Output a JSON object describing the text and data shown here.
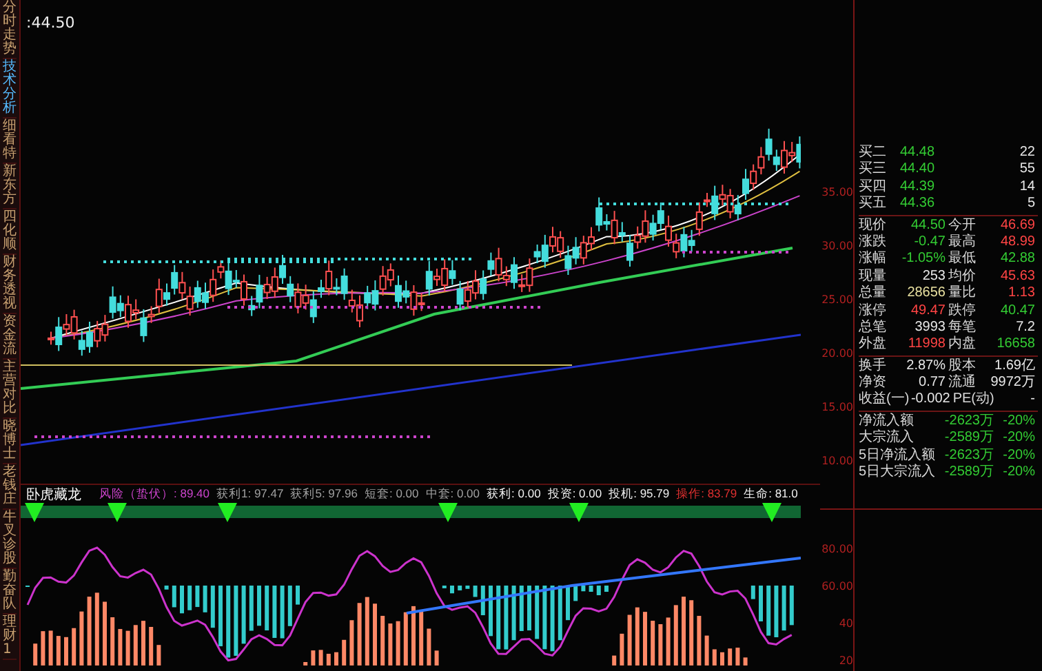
{
  "sidebar": {
    "tabs": [
      {
        "label": "分时走势",
        "selected": false
      },
      {
        "label": "技术分析",
        "selected": true
      },
      {
        "label": "细看特",
        "selected": false
      },
      {
        "label": "新东方",
        "selected": false
      },
      {
        "label": "四化顺",
        "selected": false
      },
      {
        "label": "财务透视",
        "selected": false
      },
      {
        "label": "资金流",
        "selected": false
      },
      {
        "label": "主营对比",
        "selected": false
      },
      {
        "label": "晓博士",
        "selected": false
      },
      {
        "label": "老钱庄",
        "selected": false
      },
      {
        "label": "牛叉诊股",
        "selected": false
      },
      {
        "label": "勤奋队",
        "selected": false
      },
      {
        "label": "理财1",
        "selected": false
      }
    ]
  },
  "main_chart": {
    "price_label": ":44.50",
    "axis_labels": [
      "35.00",
      "30.00",
      "25.00",
      "20.00",
      "15.00",
      "10.00"
    ]
  },
  "quote": {
    "bids": [
      {
        "label": "买二",
        "price": "44.48",
        "volume": "22"
      },
      {
        "label": "买三",
        "price": "44.40",
        "volume": "55"
      },
      {
        "label": "买四",
        "price": "44.39",
        "volume": "14"
      },
      {
        "label": "买五",
        "price": "44.36",
        "volume": "5"
      }
    ],
    "stats": [
      {
        "label": "现价",
        "value": "44.50",
        "color": "#33cc33"
      },
      {
        "label": "今开",
        "value": "46.69",
        "color": "#ff4444"
      },
      {
        "label": "涨跌",
        "value": "-0.47",
        "color": "#33cc33"
      },
      {
        "label": "最高",
        "value": "48.99",
        "color": "#ff4444"
      },
      {
        "label": "涨幅",
        "value": "-1.05%",
        "color": "#33cc33"
      },
      {
        "label": "最低",
        "value": "42.88",
        "color": "#33cc33"
      },
      {
        "label": "现量",
        "value": "253",
        "color": "#e8e8e8"
      },
      {
        "label": "均价",
        "value": "45.63",
        "color": "#ff4444"
      },
      {
        "label": "总量",
        "value": "28656",
        "color": "#e8e0a0"
      },
      {
        "label": "量比",
        "value": "1.13",
        "color": "#ff4444"
      },
      {
        "label": "涨停",
        "value": "49.47",
        "color": "#ff4444"
      },
      {
        "label": "跌停",
        "value": "40.47",
        "color": "#33cc33"
      },
      {
        "label": "总笔",
        "value": "3993",
        "color": "#e8e8e8"
      },
      {
        "label": "每笔",
        "value": "7.2",
        "color": "#e8e8e8"
      },
      {
        "label": "外盘",
        "value": "11998",
        "color": "#ff4444"
      },
      {
        "label": "内盘",
        "value": "16658",
        "color": "#33cc33"
      },
      {
        "label": "换手",
        "value": "2.87%",
        "color": "#e8e8e8"
      },
      {
        "label": "股本",
        "value": "1.69亿",
        "color": "#e8e8e8"
      },
      {
        "label": "净资",
        "value": "0.77",
        "color": "#e8e8e8"
      },
      {
        "label": "流通",
        "value": "9972万",
        "color": "#e8e8e8"
      },
      {
        "label": "收益(一)",
        "value": "-0.002",
        "color": "#e8e8e8"
      },
      {
        "label": "PE(动)",
        "value": "-",
        "color": "#e8e8e8"
      }
    ],
    "flows": [
      {
        "label": "净流入额",
        "amount": "-2623万",
        "pct": "-20%"
      },
      {
        "label": "大宗流入",
        "amount": "-2589万",
        "pct": "-20%"
      },
      {
        "label": "5日净流入额",
        "amount": "-2623万",
        "pct": "-20%"
      },
      {
        "label": "5日大宗流入",
        "amount": "-2589万",
        "pct": "-20%"
      }
    ]
  },
  "indicator": {
    "title": "卧虎藏龙",
    "readings": [
      {
        "text": "风险（蛰伏）: 89.40",
        "color": "#cc44cc"
      },
      {
        "text": "获利1: 97.47",
        "color": "#a0a0a0"
      },
      {
        "text": "获利5: 97.96",
        "color": "#a0a0a0"
      },
      {
        "text": "短套: 0.00",
        "color": "#a0a0a0"
      },
      {
        "text": "中套: 0.00",
        "color": "#a0a0a0"
      },
      {
        "text": "获利: 0.00",
        "color": "#f0f0f0"
      },
      {
        "text": "投资: 0.00",
        "color": "#f0f0f0"
      },
      {
        "text": "投机: 95.79",
        "color": "#f0f0f0"
      },
      {
        "text": "操作: 83.79",
        "color": "#e03030"
      },
      {
        "text": "生命: 81.0",
        "color": "#f0f0f0"
      }
    ],
    "axis_labels": [
      "80.00",
      "60.00",
      "40",
      "20"
    ]
  }
}
